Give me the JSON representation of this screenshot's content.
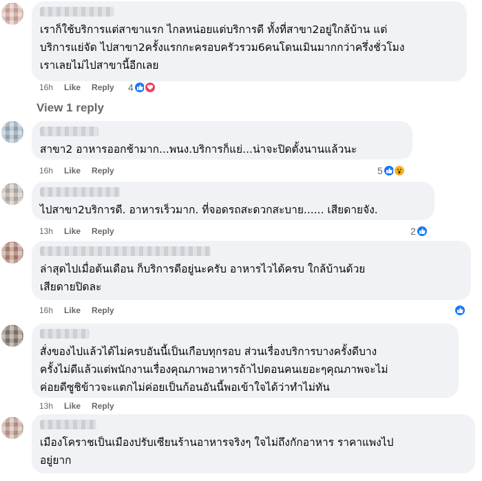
{
  "comments": [
    {
      "text": "เราก็ใช้บริการแต่สาขาแรก ไกลหน่อยแต่บริการดี ทั้งที่สาขา2อยู่ใกล้บ้าน แต่\nบริการแย่จัด ไปสาขา2ครั้งแรกกะครอบครัวรวม6คนโดนเมินมากกว่าครึ่งชั่วโมง\nเราเลยไม่ไปสาขานี้อีกเลย",
      "time": "16h",
      "like": "Like",
      "reply": "Reply",
      "reaction_count": "4",
      "reactions": [
        "like-icon",
        "love-icon"
      ]
    },
    {
      "text": "สาขา2 อาหารออกช้ามาก...พนง.บริการก็แย่...น่าจะปิดตั้งนานแล้วนะ",
      "time": "16h",
      "like": "Like",
      "reply": "Reply",
      "reaction_count": "5",
      "reactions": [
        "like-icon",
        "wow-icon"
      ]
    },
    {
      "text": "ไปสาขา2บริการดี. อาหารเร็วมาก. ที่จอดรถสะดวกสะบาย...... เสียดายจัง.",
      "time": "13h",
      "like": "Like",
      "reply": "Reply",
      "reaction_count": "2",
      "reactions": [
        "like-icon"
      ]
    },
    {
      "text": "ล่าสุดไปเมื่อต้นเดือน ก็บริการดีอยู่นะครับ อาหารไวได้ครบ ใกล้บ้านด้วย\nเสียดายปิดละ",
      "time": "16h",
      "like": "Like",
      "reply": "Reply",
      "reaction_count": "",
      "reactions": [
        "like-icon"
      ]
    },
    {
      "text": "สั่งของไปแล้วได้ไม่ครบอันนี้เป็นเกือบทุกรอบ ส่วนเรื่องบริการบางครั้งดีบาง\nครั้งไม่ดีแล้วแต่พนักงานเรื่องคุณภาพอาหารถ้าไปตอนคนเยอะๆคุณภาพจะไม่\nค่อยดีซูชิข้าวจะแตกไม่ค่อยเป็นก้อนอันนี้พอเข้าใจได้ว่าทำไม่ทัน",
      "time": "13h",
      "like": "Like",
      "reply": "Reply",
      "reaction_count": "",
      "reactions": []
    },
    {
      "text": "เมืองโคราชเป็นเมืองปรับเซียนร้านอาหารจริงๆ ใจไม่ถึงกักอาหาร ราคาแพงไป\nอยู่ยาก",
      "time": "",
      "like": "",
      "reply": "",
      "reaction_count": "",
      "reactions": []
    }
  ],
  "view_replies_label": "View 1 reply",
  "colors": {
    "like": "#1877f2",
    "love": "#f33e58",
    "wow": "#f7b125",
    "bubble": "#f0f2f5",
    "meta": "#65676b"
  }
}
